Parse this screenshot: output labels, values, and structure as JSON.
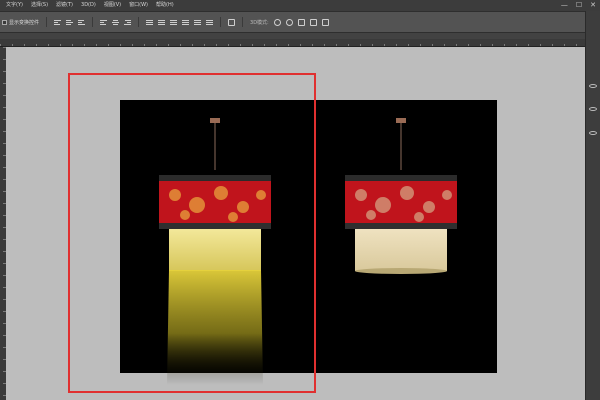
{
  "menubar": {
    "items": [
      "文字(Y)",
      "选择(S)",
      "滤镜(T)",
      "3D(D)",
      "视图(V)",
      "窗口(W)",
      "帮助(H)"
    ],
    "minimize": "—",
    "maximize": "☐",
    "close": "✕"
  },
  "options_bar": {
    "transform_label": "显示变换控件"
  },
  "colors": {
    "selection_outline": "#e03030",
    "document_bg": "#000000",
    "lampshade_red": "#c0141c",
    "beam_yellow": "#e6d23c"
  },
  "icons": [
    "align-left-icon",
    "align-center-icon",
    "align-right-icon",
    "distribute-icon",
    "3d-rotate-icon",
    "eye-icon"
  ]
}
